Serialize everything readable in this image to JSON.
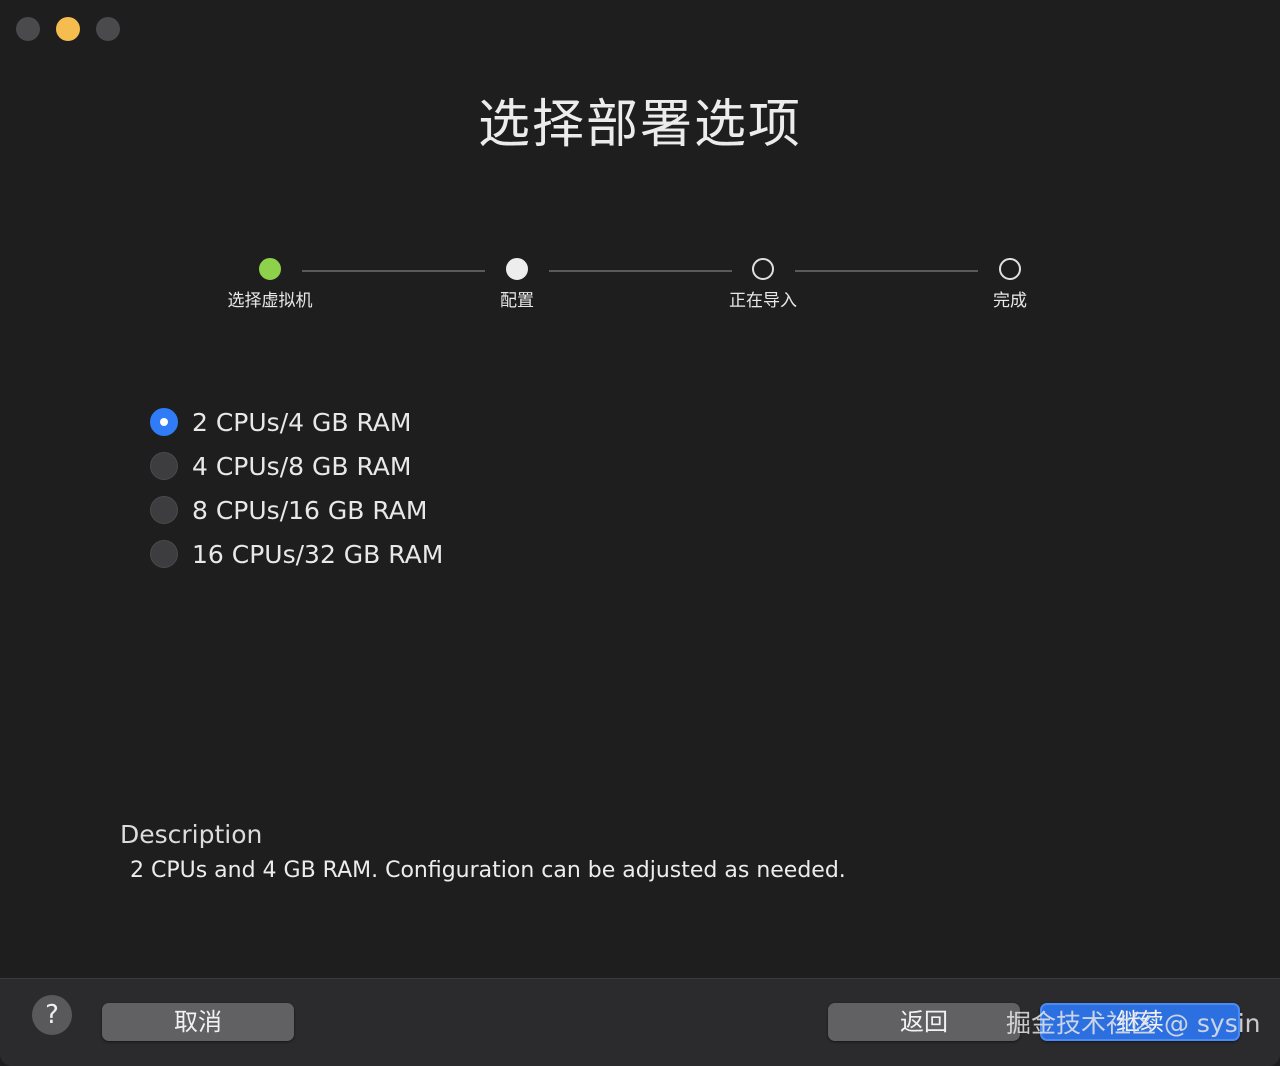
{
  "title": "选择部署选项",
  "stepper": {
    "steps": [
      {
        "label": "选择虚拟机",
        "state": "done"
      },
      {
        "label": "配置",
        "state": "current"
      },
      {
        "label": "正在导入",
        "state": "pending"
      },
      {
        "label": "完成",
        "state": "pending"
      }
    ]
  },
  "options": {
    "items": [
      {
        "label": "2 CPUs/4 GB RAM",
        "checked": true
      },
      {
        "label": "4 CPUs/8 GB RAM",
        "checked": false
      },
      {
        "label": "8 CPUs/16 GB RAM",
        "checked": false
      },
      {
        "label": "16 CPUs/32 GB RAM",
        "checked": false
      }
    ]
  },
  "description": {
    "heading": "Description",
    "text": "2 CPUs and 4 GB RAM. Configuration can be adjusted as needed."
  },
  "footer": {
    "help_label": "?",
    "cancel_label": "取消",
    "back_label": "返回",
    "continue_label": "继续"
  },
  "watermark": "掘金技术社区 @ sysin",
  "colors": {
    "background": "#1e1e1f",
    "accent": "#2f7cf6",
    "step_done": "#8ed14a",
    "traffic_yellow": "#f5bd4f"
  }
}
